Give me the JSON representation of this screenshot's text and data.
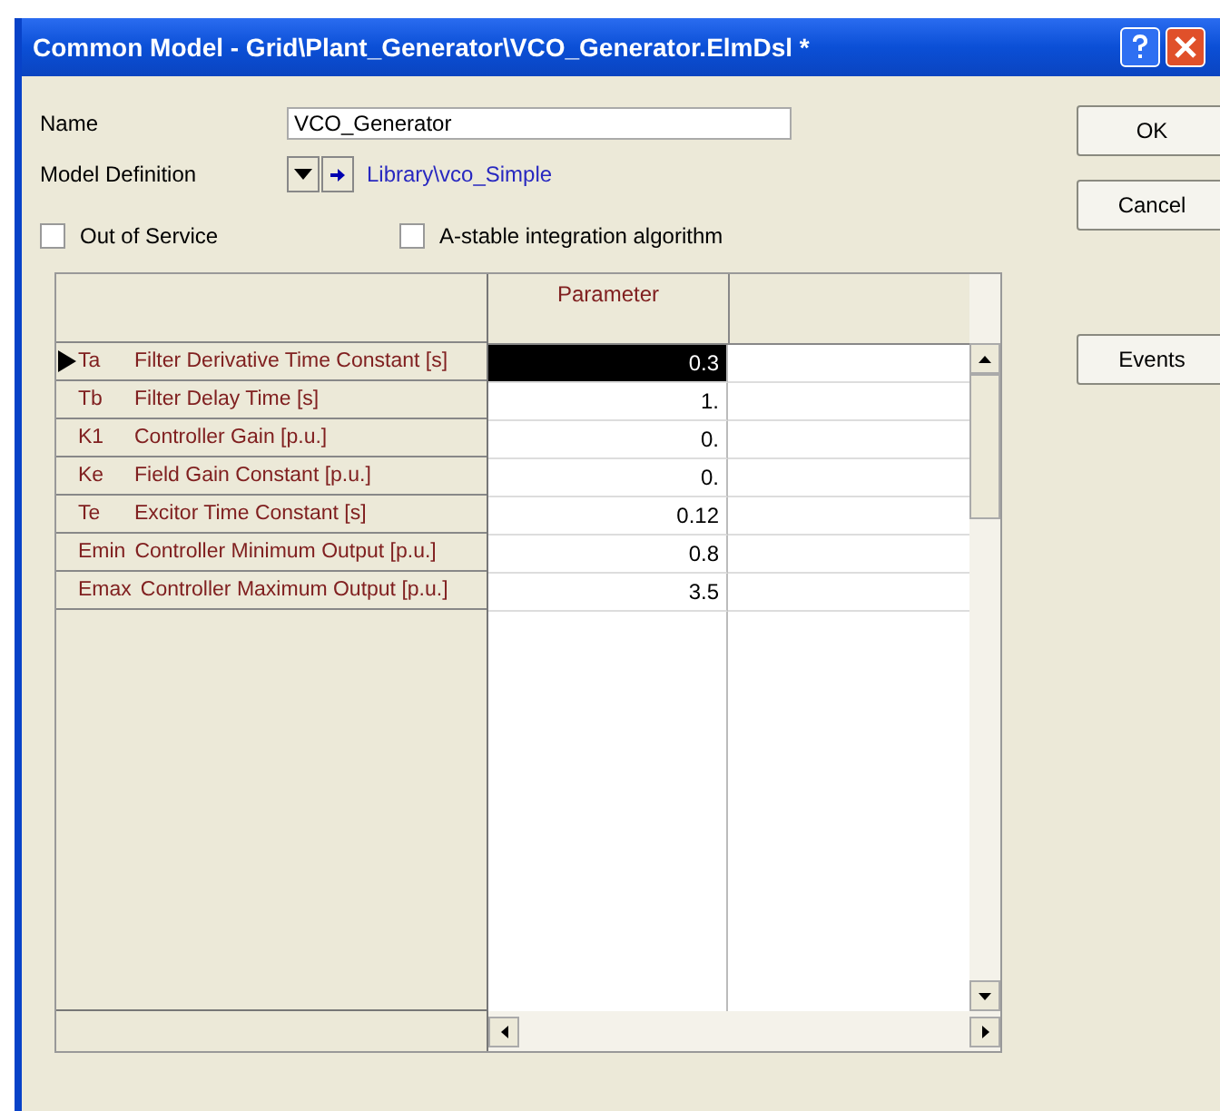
{
  "window": {
    "title": "Common Model - Grid\\Plant_Generator\\VCO_Generator.ElmDsl *"
  },
  "name_field": {
    "label": "Name",
    "value": "VCO_Generator"
  },
  "model_definition": {
    "label": "Model Definition",
    "link": "Library\\vco_Simple"
  },
  "checkboxes": [
    {
      "label": "Out of Service",
      "checked": false
    },
    {
      "label": "A-stable integration algorithm",
      "checked": false
    }
  ],
  "table": {
    "columns": [
      "Parameter"
    ],
    "rows": [
      {
        "symbol": "Ta",
        "description": "Filter Derivative Time Constant [s]",
        "value": "0.3",
        "selected": true
      },
      {
        "symbol": "Tb",
        "description": "Filter Delay Time [s]",
        "value": "1.",
        "selected": false
      },
      {
        "symbol": "K1",
        "description": "Controller Gain [p.u.]",
        "value": "0.",
        "selected": false
      },
      {
        "symbol": "Ke",
        "description": "Field Gain Constant [p.u.]",
        "value": "0.",
        "selected": false
      },
      {
        "symbol": "Te",
        "description": "Excitor Time Constant [s]",
        "value": "0.12",
        "selected": false
      },
      {
        "symbol": "Emin",
        "description": "Controller Minimum Output [p.u.]",
        "value": "0.8",
        "selected": false
      },
      {
        "symbol": "Emax",
        "description": "Controller Maximum Output [p.u.]",
        "value": "3.5",
        "selected": false
      }
    ]
  },
  "buttons": [
    {
      "label": "OK"
    },
    {
      "label": "Cancel"
    },
    {
      "label": "Events"
    }
  ]
}
